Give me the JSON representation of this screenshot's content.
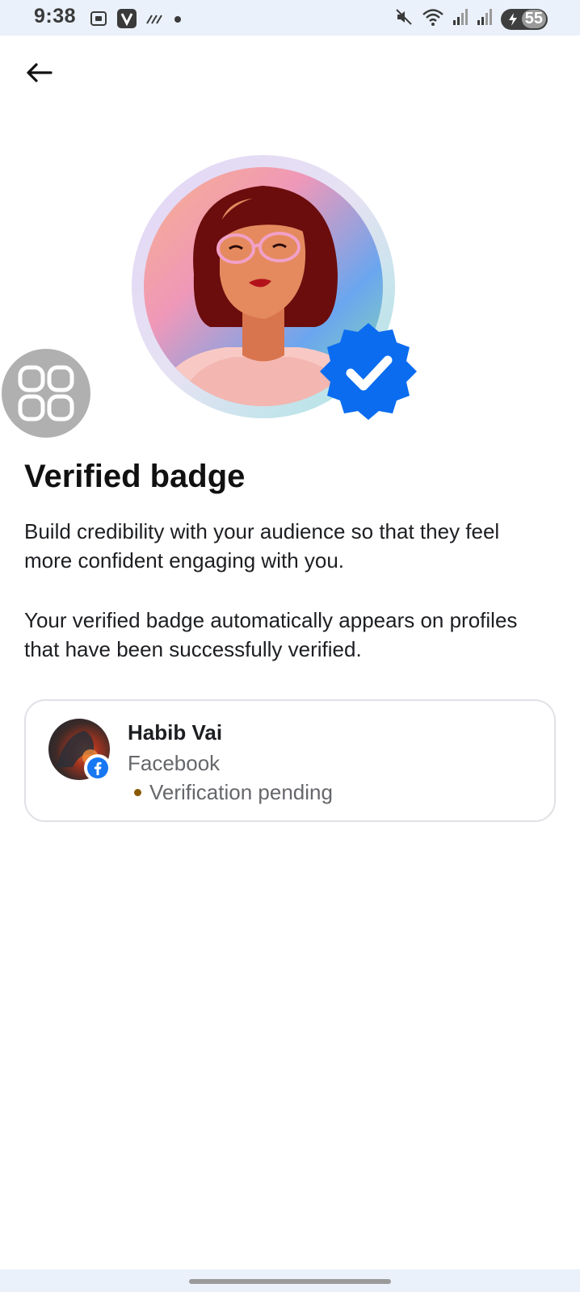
{
  "status_bar": {
    "time": "9:38",
    "battery": "55",
    "icons": [
      "screenshot-icon",
      "v-app-icon",
      "signal-strike-icon",
      "dot-icon",
      "mute-icon",
      "wifi-icon",
      "signal-icon",
      "signal-icon",
      "battery-icon"
    ]
  },
  "header": {
    "back_icon": "arrow-left-icon"
  },
  "hero": {
    "badge_icon": "verified-check-icon"
  },
  "content": {
    "title": "Verified badge",
    "description_1": "Build credibility with your audience so that they feel more confident engaging with you.",
    "description_2": "Your verified badge automatically appears on profiles that have been successfully verified."
  },
  "account": {
    "name": "Habib Vai",
    "platform": "Facebook",
    "status": "Verification pending",
    "status_color": "#8a5a00"
  },
  "colors": {
    "accent": "#1877f2",
    "badge": "#0b6cf0"
  }
}
